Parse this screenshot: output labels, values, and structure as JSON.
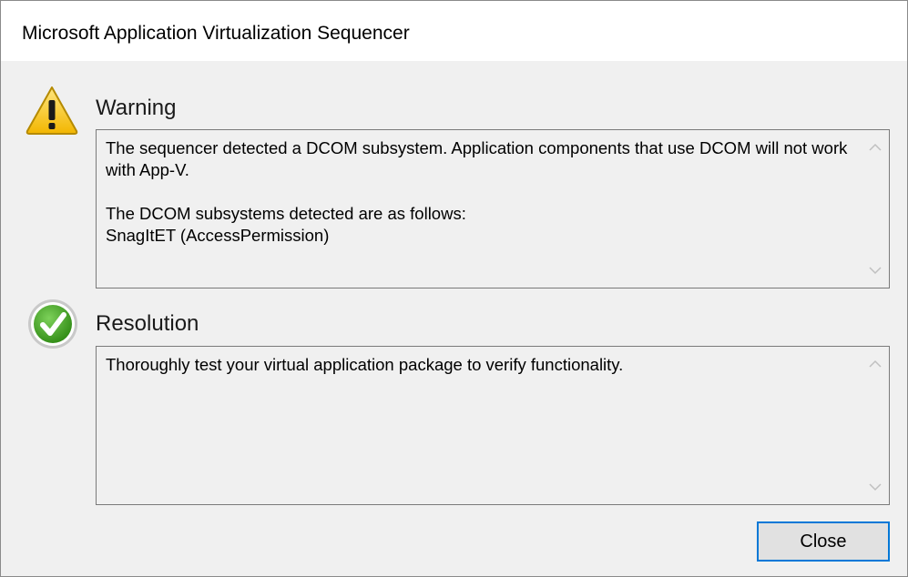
{
  "window": {
    "title": "Microsoft Application Virtualization Sequencer"
  },
  "warning": {
    "icon": "warning-triangle-icon",
    "heading": "Warning",
    "text": "The sequencer detected a DCOM subsystem. Application components that use DCOM will not work with App-V.\n\nThe DCOM subsystems detected are as follows:\nSnagItET (AccessPermission)"
  },
  "resolution": {
    "icon": "checkmark-circle-icon",
    "heading": "Resolution",
    "text": "Thoroughly test your virtual application package to verify functionality."
  },
  "buttons": {
    "close_label": "Close"
  },
  "colors": {
    "dialog_background": "#f0f0f0",
    "titlebar_background": "#ffffff",
    "warning_icon": "#f5c400",
    "check_icon": "#3a9a1d",
    "button_focus_border": "#0078d7"
  }
}
